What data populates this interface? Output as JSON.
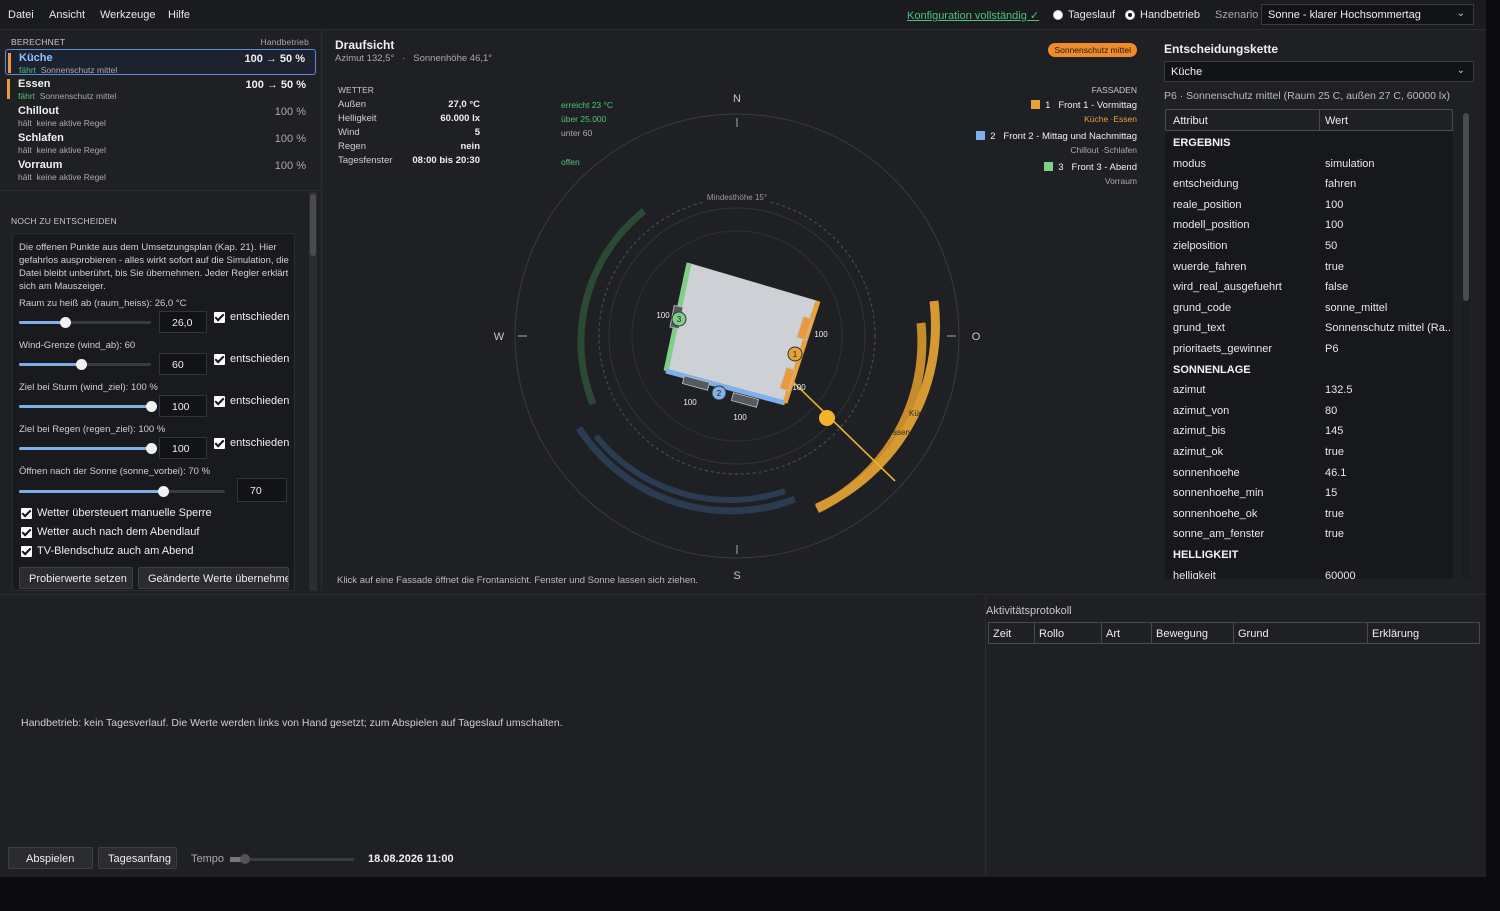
{
  "menu": {
    "items": [
      "Datei",
      "Ansicht",
      "Werkzeuge",
      "Hilfe"
    ]
  },
  "header": {
    "config_status": "Konfiguration vollständig ✓",
    "mode_options": [
      {
        "label": "Tageslauf",
        "selected": false
      },
      {
        "label": "Handbetrieb",
        "selected": true
      }
    ],
    "scenario_label": "Szenario",
    "scenario_value": "Sonne - klarer Hochsommertag"
  },
  "left": {
    "computed_header": "BERECHNET",
    "mode_header": "Handbetrieb",
    "rooms": [
      {
        "name": "Küche",
        "state": "fährt",
        "reason": "Sonnenschutz mittel",
        "value": "100 → 50 %",
        "active": true,
        "selected": true
      },
      {
        "name": "Essen",
        "state": "fährt",
        "reason": "Sonnenschutz mittel",
        "value": "100 → 50 %",
        "active": true,
        "selected": false
      },
      {
        "name": "Chillout",
        "state": "hält",
        "reason": "keine aktive Regel",
        "value": "100 %",
        "active": false,
        "selected": false
      },
      {
        "name": "Schlafen",
        "state": "hält",
        "reason": "keine aktive Regel",
        "value": "100 %",
        "active": false,
        "selected": false
      },
      {
        "name": "Vorraum",
        "state": "hält",
        "reason": "keine aktive Regel",
        "value": "100 %",
        "active": false,
        "selected": false
      }
    ],
    "decide_header": "NOCH ZU ENTSCHEIDEN",
    "decide_text": "Die offenen Punkte aus dem Umsetzungsplan (Kap. 21). Hier gefahrlos ausprobieren - alles wirkt sofort auf die Simulation, die Datei bleibt unberührt, bis Sie übernehmen. Jeder Regler erklärt sich am Mauszeiger.",
    "sliders": [
      {
        "label": "Raum zu heiß ab (raum_heiss):",
        "shown": "26,0 °C",
        "value": "26,0",
        "fraction": 0.35,
        "check": "entschieden"
      },
      {
        "label": "Wind-Grenze (wind_ab):",
        "shown": "60",
        "value": "60",
        "fraction": 0.47,
        "check": "entschieden"
      },
      {
        "label": "Ziel bei Sturm (wind_ziel):",
        "shown": "100 %",
        "value": "100",
        "fraction": 1.0,
        "check": "entschieden"
      },
      {
        "label": "Ziel bei Regen (regen_ziel):",
        "shown": "100 %",
        "value": "100",
        "fraction": 1.0,
        "check": "entschieden"
      },
      {
        "label": "Öffnen nach der Sonne (sonne_vorbei):",
        "shown": "70 %",
        "value": "70",
        "fraction": 0.7,
        "check": ""
      }
    ],
    "checkboxes": [
      "Wetter übersteuert manuelle Sperre",
      "Wetter auch nach dem Abendlauf",
      "TV-Blendschutz auch am Abend"
    ],
    "btn_probe": "Probierwerte setzen",
    "btn_apply": "Geänderte Werte übernehmen"
  },
  "center": {
    "title": "Draufsicht",
    "azimuth": "Azimut 132,5°",
    "sep": "·",
    "elevation": "Sonnenhöhe 46,1°",
    "badge": "Sonnenschutz mittel",
    "weather_header": "WETTER",
    "weather": [
      {
        "k": "Außen",
        "v": "27,0 °C",
        "note": "erreicht 23 °C",
        "ok": true
      },
      {
        "k": "Helligkeit",
        "v": "60.000 lx",
        "note": "über 25.000",
        "ok": true
      },
      {
        "k": "Wind",
        "v": "5",
        "note": "unter 60",
        "ok": false
      },
      {
        "k": "Regen",
        "v": "nein",
        "note": "",
        "ok": false
      },
      {
        "k": "Tagesfenster",
        "v": "08:00 bis 20:30",
        "note": "offen",
        "ok": true
      }
    ],
    "facades_header": "FASSADEN",
    "facades": [
      {
        "num": "1",
        "name": "Front 1 - Vormittag",
        "rooms": "Küche ·Essen",
        "color": "#e8a23a",
        "active": true
      },
      {
        "num": "2",
        "name": "Front 2 - Mittag und Nachmittag",
        "rooms": "Chillout ·Schlafen",
        "color": "#7fb0ea",
        "active": false
      },
      {
        "num": "3",
        "name": "Front 3 - Abend",
        "rooms": "Vorraum",
        "color": "#7fcf88",
        "active": false
      }
    ],
    "compass": {
      "n": "N",
      "s": "S",
      "w": "W",
      "o": "O"
    },
    "min_height": "Mindesthöhe 15°",
    "window_labels": [
      "100",
      "100",
      "100",
      "100",
      "100"
    ],
    "marker_nums": [
      "1",
      "2",
      "3"
    ],
    "arc_labels": [
      "Küch",
      "ssen"
    ],
    "hint": "Klick auf eine Fassade öffnet die Frontansicht. Fenster und Sonne lassen sich ziehen."
  },
  "right": {
    "title": "Entscheidungskette",
    "room_select": "Küche",
    "subtitle": "P6 · Sonnenschutz mittel (Raum 25 C, außen 27 C, 60000 lx)",
    "col_attr": "Attribut",
    "col_value": "Wert",
    "rows": [
      {
        "a": "ERGEBNIS",
        "w": "",
        "group": true
      },
      {
        "a": "modus",
        "w": "simulation"
      },
      {
        "a": "entscheidung",
        "w": "fahren"
      },
      {
        "a": "reale_position",
        "w": "100"
      },
      {
        "a": "modell_position",
        "w": "100"
      },
      {
        "a": "zielposition",
        "w": "50"
      },
      {
        "a": "wuerde_fahren",
        "w": "true"
      },
      {
        "a": "wird_real_ausgefuehrt",
        "w": "false"
      },
      {
        "a": "grund_code",
        "w": "sonne_mittel"
      },
      {
        "a": "grund_text",
        "w": "Sonnenschutz mittel (Ra..."
      },
      {
        "a": "prioritaets_gewinner",
        "w": "P6"
      },
      {
        "a": "SONNENLAGE",
        "w": "",
        "group": true
      },
      {
        "a": "azimut",
        "w": "132.5"
      },
      {
        "a": "azimut_von",
        "w": "80"
      },
      {
        "a": "azimut_bis",
        "w": "145"
      },
      {
        "a": "azimut_ok",
        "w": "true"
      },
      {
        "a": "sonnenhoehe",
        "w": "46.1"
      },
      {
        "a": "sonnenhoehe_min",
        "w": "15"
      },
      {
        "a": "sonnenhoehe_ok",
        "w": "true"
      },
      {
        "a": "sonne_am_fenster",
        "w": "true"
      },
      {
        "a": "HELLIGKEIT",
        "w": "",
        "group": true
      },
      {
        "a": "helligkeit",
        "w": "60000"
      }
    ]
  },
  "bottom": {
    "message": "Handbetrieb: kein Tagesverlauf. Die Werte werden links von Hand gesetzt; zum Abspielen auf Tageslauf umschalten.",
    "btn_play": "Abspielen",
    "btn_start": "Tagesanfang",
    "tempo_label": "Tempo",
    "datetime": "18.08.2026  11:00"
  },
  "log": {
    "title": "Aktivitätsprotokoll",
    "columns": [
      "Zeit",
      "Rollo",
      "Art",
      "Bewegung",
      "Grund",
      "Erklärung"
    ]
  },
  "colors": {
    "accent_orange": "#f08a2a",
    "sun_yellow": "#f2b52a",
    "facade_blue": "#7fb0ea",
    "facade_green": "#7fcf88",
    "ok_green": "#4fc27a"
  },
  "icons": {
    "select": "chevron-down-icon",
    "check": "checkmark-icon"
  }
}
